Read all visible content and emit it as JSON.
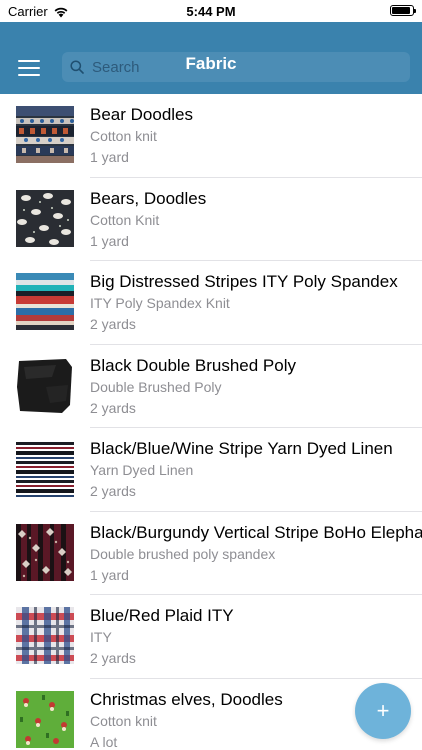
{
  "status_bar": {
    "carrier": "Carrier",
    "time": "5:44 PM"
  },
  "nav": {
    "title": "Fabric",
    "search_placeholder": "Search",
    "menu_icon": "hamburger-menu-icon",
    "search_icon": "magnifier-icon"
  },
  "colors": {
    "nav_background": "#3a82ad",
    "fab_background": "#6eb3da",
    "subtitle_text": "#8e8e93"
  },
  "fabrics": [
    {
      "name": "Bear Doodles",
      "type": "Cotton knit",
      "quantity": "1 yard"
    },
    {
      "name": "Bears, Doodles",
      "type": "Cotton Knit",
      "quantity": "1 yard"
    },
    {
      "name": "Big Distressed Stripes ITY Poly Spandex",
      "type": "ITY Poly Spandex Knit",
      "quantity": "2 yards"
    },
    {
      "name": "Black Double Brushed Poly",
      "type": "Double Brushed Poly",
      "quantity": "2 yards"
    },
    {
      "name": "Black/Blue/Wine Stripe Yarn Dyed Linen",
      "type": "Yarn Dyed Linen",
      "quantity": "2 yards"
    },
    {
      "name": "Black/Burgundy Vertical Stripe BoHo Elephants",
      "type": "Double brushed poly spandex",
      "quantity": "1 yard"
    },
    {
      "name": "Blue/Red Plaid ITY",
      "type": "ITY",
      "quantity": "2 yards"
    },
    {
      "name": "Christmas elves, Doodles",
      "type": "Cotton knit",
      "quantity": "A lot"
    }
  ],
  "fab": {
    "label": "+",
    "icon": "add-icon"
  }
}
